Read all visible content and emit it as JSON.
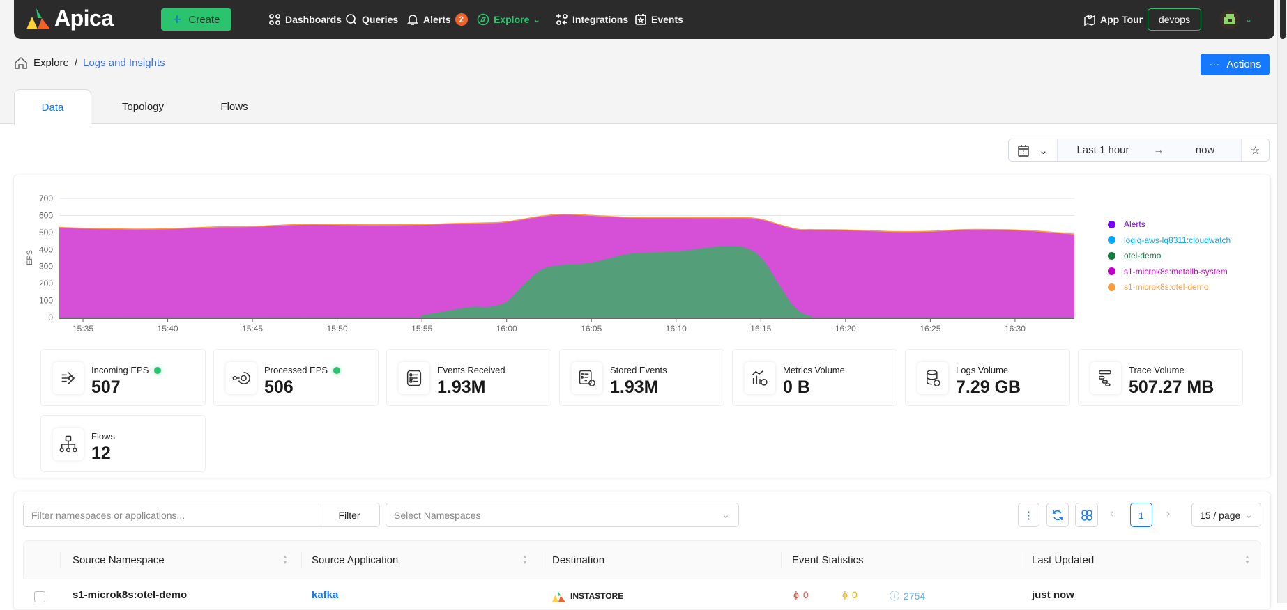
{
  "nav": {
    "brand": "Apica",
    "create": "Create",
    "items": [
      {
        "label": "Dashboards"
      },
      {
        "label": "Queries"
      },
      {
        "label": "Alerts",
        "badge": "2"
      },
      {
        "label": "Explore"
      },
      {
        "label": "Integrations"
      },
      {
        "label": "Events"
      }
    ],
    "app_tour": "App Tour",
    "org": "devops"
  },
  "breadcrumb": {
    "root": "Explore",
    "sep": "/",
    "current": "Logs and Insights"
  },
  "actions": {
    "label": "Actions",
    "dots": "···"
  },
  "tabs": [
    {
      "label": "Data"
    },
    {
      "label": "Topology"
    },
    {
      "label": "Flows"
    }
  ],
  "timepicker": {
    "from": "Last 1 hour",
    "to": "now"
  },
  "colors": {
    "alerts": "#7b00ff",
    "cloudwatch": "#00aaff",
    "otel": "#157a3e",
    "metallb": "#c000c8",
    "s1otel": "#ff9a3c"
  },
  "chart_data": {
    "type": "area",
    "ylabel": "EPS",
    "ylim": [
      0,
      700
    ],
    "yticks": [
      0,
      100,
      200,
      300,
      400,
      500,
      600,
      700
    ],
    "x_unit": "minutes after 15:00",
    "xlim": [
      33.6,
      93.5
    ],
    "xticks": [
      {
        "x": 35,
        "label": "15:35"
      },
      {
        "x": 40,
        "label": "15:40"
      },
      {
        "x": 45,
        "label": "15:45"
      },
      {
        "x": 50,
        "label": "15:50"
      },
      {
        "x": 55,
        "label": "15:55"
      },
      {
        "x": 60,
        "label": "16:00"
      },
      {
        "x": 65,
        "label": "16:05"
      },
      {
        "x": 70,
        "label": "16:10"
      },
      {
        "x": 75,
        "label": "16:15"
      },
      {
        "x": 80,
        "label": "16:20"
      },
      {
        "x": 85,
        "label": "16:25"
      },
      {
        "x": 90,
        "label": "16:30"
      }
    ],
    "legend_position": "right",
    "series": [
      {
        "name": "Alerts",
        "color": "#7b00ff",
        "points": []
      },
      {
        "name": "logiq-aws-lq8311:cloudwatch",
        "color": "#00aaff",
        "points": []
      },
      {
        "name": "s1-microk8s:metallb-system",
        "color": "#c000c8",
        "fill": "#d44bd6",
        "points": [
          [
            33.6,
            530
          ],
          [
            35,
            525
          ],
          [
            38,
            520
          ],
          [
            40,
            522
          ],
          [
            43,
            533
          ],
          [
            45,
            535
          ],
          [
            48,
            548
          ],
          [
            50,
            547
          ],
          [
            52,
            545
          ],
          [
            55,
            547
          ],
          [
            57,
            553
          ],
          [
            59,
            557
          ],
          [
            60,
            563
          ],
          [
            62,
            595
          ],
          [
            63,
            606
          ],
          [
            64,
            606
          ],
          [
            67,
            590
          ],
          [
            70,
            588
          ],
          [
            73,
            587
          ],
          [
            74,
            587
          ],
          [
            75,
            578
          ],
          [
            77,
            522
          ],
          [
            78,
            517
          ],
          [
            80,
            515
          ],
          [
            83,
            505
          ],
          [
            85,
            507
          ],
          [
            87,
            517
          ],
          [
            89,
            517
          ],
          [
            91,
            510
          ],
          [
            93.5,
            490
          ]
        ]
      },
      {
        "name": "otel-demo",
        "color": "#157a3e",
        "fill": "#52a077",
        "points": [
          [
            33.6,
            0
          ],
          [
            54,
            0
          ],
          [
            55,
            10
          ],
          [
            57,
            45
          ],
          [
            58,
            60
          ],
          [
            59,
            60
          ],
          [
            60,
            90
          ],
          [
            61,
            190
          ],
          [
            62,
            275
          ],
          [
            63,
            303
          ],
          [
            65,
            320
          ],
          [
            67,
            368
          ],
          [
            68,
            378
          ],
          [
            70,
            385
          ],
          [
            72,
            410
          ],
          [
            73,
            417
          ],
          [
            74,
            410
          ],
          [
            75,
            350
          ],
          [
            76,
            200
          ],
          [
            77,
            55
          ],
          [
            78,
            3
          ],
          [
            79,
            0
          ],
          [
            93.5,
            0
          ]
        ]
      },
      {
        "name": "s1-microk8s:otel-demo",
        "color": "#ff9a3c",
        "points": []
      }
    ]
  },
  "legend": [
    "Alerts",
    "logiq-aws-lq8311:cloudwatch",
    "otel-demo",
    "s1-microk8s:metallb-system",
    "s1-microk8s:otel-demo"
  ],
  "stats": [
    {
      "label": "Incoming EPS",
      "value": "507",
      "live": true
    },
    {
      "label": "Processed EPS",
      "value": "506",
      "live": true
    },
    {
      "label": "Events Received",
      "value": "1.93M"
    },
    {
      "label": "Stored Events",
      "value": "1.93M"
    },
    {
      "label": "Metrics Volume",
      "value": "0 B"
    },
    {
      "label": "Logs Volume",
      "value": "7.29 GB"
    },
    {
      "label": "Trace Volume",
      "value": "507.27 MB"
    },
    {
      "label": "Flows",
      "value": "12"
    }
  ],
  "table": {
    "filter_placeholder": "Filter namespaces or applications...",
    "filter_button": "Filter",
    "namespace_placeholder": "Select Namespaces",
    "page": "1",
    "page_size": "15 / page",
    "columns": [
      "Source Namespace",
      "Source Application",
      "Destination",
      "Event Statistics",
      "Last Updated"
    ],
    "rows": [
      {
        "namespace": "s1-microk8s:otel-demo",
        "application": "kafka",
        "destination": "INSTASTORE",
        "errors": "0",
        "warnings": "0",
        "info": "2754",
        "updated": "just now"
      }
    ]
  }
}
